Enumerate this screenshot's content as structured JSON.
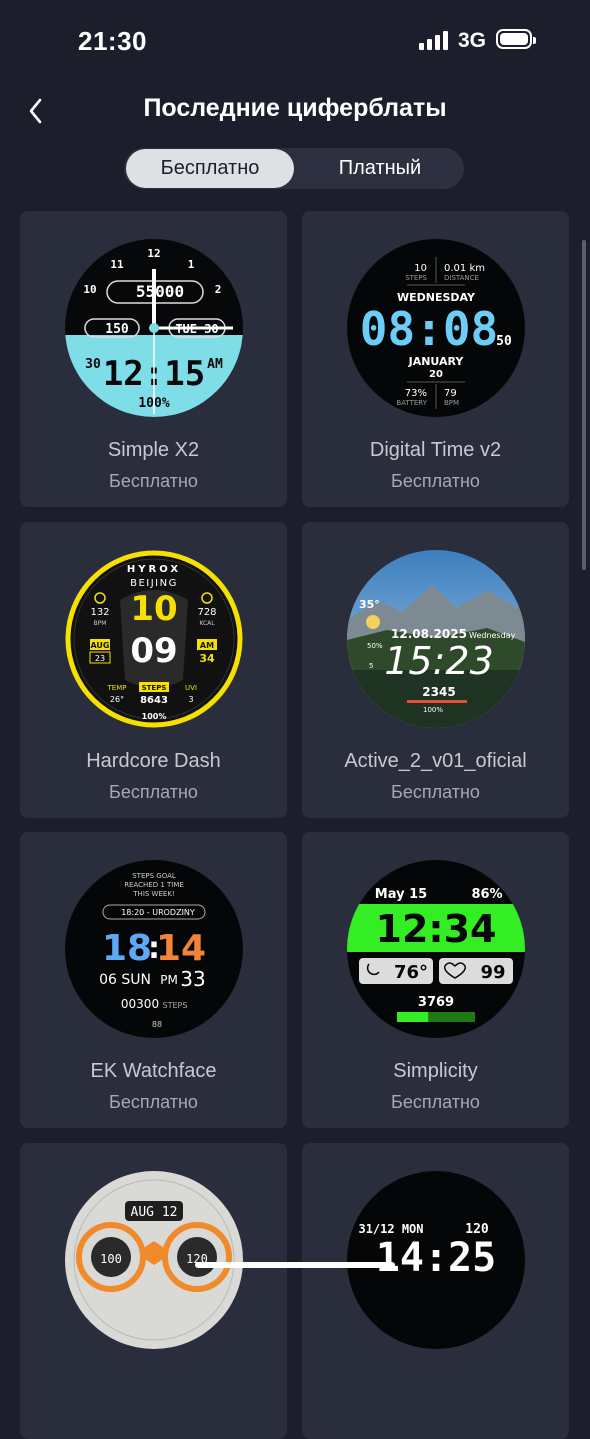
{
  "status_bar": {
    "time": "21:30",
    "network": "3G"
  },
  "header": {
    "title": "Последние циферблаты"
  },
  "tabs": [
    {
      "label": "Бесплатно",
      "selected": true
    },
    {
      "label": "Платный",
      "selected": false
    }
  ],
  "watchfaces": [
    {
      "name": "Simple X2",
      "price": "Бесплатно",
      "face": {
        "steps": "55000",
        "heart": "150",
        "date": "TUE 30",
        "day": "30",
        "time": "12:15",
        "ampm": "AM",
        "battery": "100%",
        "hours": [
          "12",
          "11",
          "1",
          "10",
          "2"
        ]
      }
    },
    {
      "name": "Digital Time v2",
      "price": "Бесплатно",
      "face": {
        "steps_value": "10",
        "steps_label": "STEPS",
        "distance_value": "0.01 km",
        "distance_label": "DISTANCE",
        "weekday": "WEDNESDAY",
        "time": "08:08",
        "seconds": "50",
        "month": "JANUARY",
        "day": "20",
        "battery_value": "73%",
        "battery_label": "BATTERY",
        "bpm_value": "79",
        "bpm_label": "BPM"
      }
    },
    {
      "name": "Hardcore Dash",
      "price": "Бесплатно",
      "face": {
        "brand": "HYROX",
        "city": "BEIJING",
        "hour": "10",
        "minute": "09",
        "bpm_value": "132",
        "bpm_label": "BPM",
        "kcal_value": "728",
        "kcal_label": "KCAL",
        "month": "AUG",
        "day": "23",
        "ampm": "AM",
        "ampm_value": "34",
        "temp_label": "TEMP",
        "temp_value": "26°",
        "steps_label": "STEPS",
        "steps_value": "8643",
        "uvi_label": "UVI",
        "uvi_value": "3",
        "battery": "100%"
      }
    },
    {
      "name": "Active_2_v01_oficial",
      "price": "Бесплатно",
      "face": {
        "temp": "35°",
        "humidity": "50%",
        "wind": "5",
        "date": "12.08.2025",
        "weekday": "Wednesday",
        "time": "15:23",
        "steps": "2345",
        "battery": "100%"
      }
    },
    {
      "name": "EK Watchface",
      "price": "Бесплатно",
      "face": {
        "goal_line1": "STEPS GOAL",
        "goal_line2": "REACHED 1 TIME",
        "goal_line3": "THIS WEEK!",
        "event": "18:20 - URODZINY",
        "hour": "18",
        "minute": "14",
        "date": "06 SUN",
        "ampm": "PM",
        "seconds": "33",
        "steps": "00300",
        "steps_label": "STEPS",
        "battery": "88"
      }
    },
    {
      "name": "Simplicity",
      "price": "Бесплатно",
      "face": {
        "date": "May 15",
        "battery": "86%",
        "time": "12:34",
        "temp": "76°",
        "heart": "99",
        "steps": "3769",
        "steps_progress": 0.4
      }
    },
    {
      "name": "",
      "price": "",
      "face": {
        "label": "AUG 12",
        "left_value": "100",
        "right_value": "120"
      }
    },
    {
      "name": "",
      "price": "",
      "face": {
        "date": "31/12 MON",
        "heart": "120",
        "time": "14:25"
      }
    }
  ]
}
